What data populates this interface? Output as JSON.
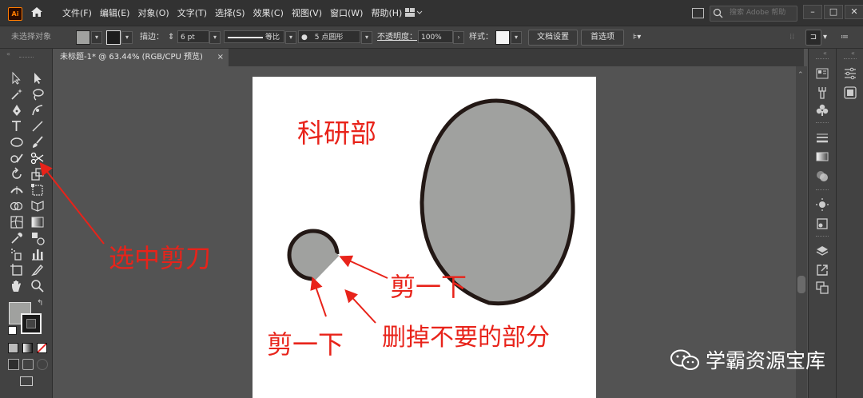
{
  "app": {
    "logo": "Ai"
  },
  "menu": [
    "文件(F)",
    "编辑(E)",
    "对象(O)",
    "文字(T)",
    "选择(S)",
    "效果(C)",
    "视图(V)",
    "窗口(W)",
    "帮助(H)"
  ],
  "search": {
    "placeholder": "搜索 Adobe 帮助"
  },
  "window_controls": {
    "minimize": "–",
    "maximize": "□",
    "close": "✕"
  },
  "control_bar": {
    "selection_label": "未选择对象",
    "stroke_label": "描边：",
    "stroke_value": "6 pt",
    "profile_label": "等比",
    "brush_label": "5 点圆形",
    "opacity_label": "不透明度：",
    "opacity_value": "100%",
    "style_label": "样式：",
    "doc_setup_button": "文档设置",
    "preferences_button": "首选项"
  },
  "document_tab": {
    "title": "未标题-1* @ 63.44% (RGB/CPU 预览)",
    "close": "×"
  },
  "artwork": {
    "title_text": "科研部",
    "annotation_scissors": "选中剪刀",
    "annotation_cut_right": "剪一下",
    "annotation_cut_left": "剪一下",
    "annotation_delete": "删掉不要的部分",
    "fill_color": "#a0a19f",
    "stroke_color": "#231815",
    "annotation_color": "#e8231a"
  },
  "watermark": {
    "text": "学霸资源宝库"
  }
}
